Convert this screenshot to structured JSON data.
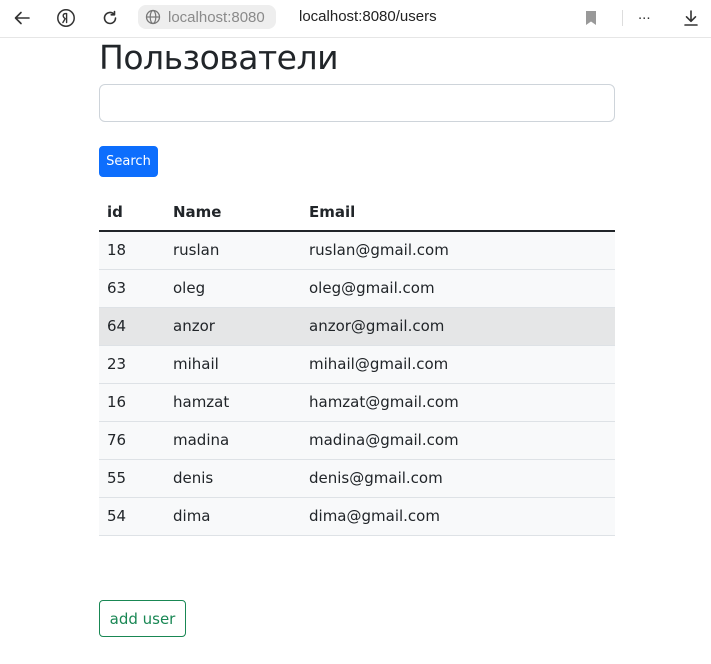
{
  "browser": {
    "url_host": "localhost:8080",
    "url_full": "localhost:8080/users",
    "menu_dots": "..."
  },
  "page": {
    "title": "Пользователи",
    "search_value": "",
    "search_button": "Search",
    "add_button": "add user"
  },
  "table": {
    "headers": [
      "id",
      "Name",
      "Email"
    ],
    "rows": [
      {
        "id": "18",
        "name": "ruslan",
        "email": "ruslan@gmail.com"
      },
      {
        "id": "63",
        "name": "oleg",
        "email": "oleg@gmail.com"
      },
      {
        "id": "64",
        "name": "anzor",
        "email": "anzor@gmail.com"
      },
      {
        "id": "23",
        "name": "mihail",
        "email": "mihail@gmail.com"
      },
      {
        "id": "16",
        "name": "hamzat",
        "email": "hamzat@gmail.com"
      },
      {
        "id": "76",
        "name": "madina",
        "email": "madina@gmail.com"
      },
      {
        "id": "55",
        "name": "denis",
        "email": "denis@gmail.com"
      },
      {
        "id": "54",
        "name": "dima",
        "email": "dima@gmail.com"
      }
    ],
    "hovered_row": 2
  },
  "colors": {
    "primary": "#0d6efd",
    "success": "#198754",
    "row_stripe": "#f8f9fa",
    "row_hover": "#e5e6e7"
  },
  "icons": [
    "back-arrow-icon",
    "yandex-icon",
    "reload-icon",
    "globe-icon",
    "bookmark-icon",
    "download-icon"
  ]
}
